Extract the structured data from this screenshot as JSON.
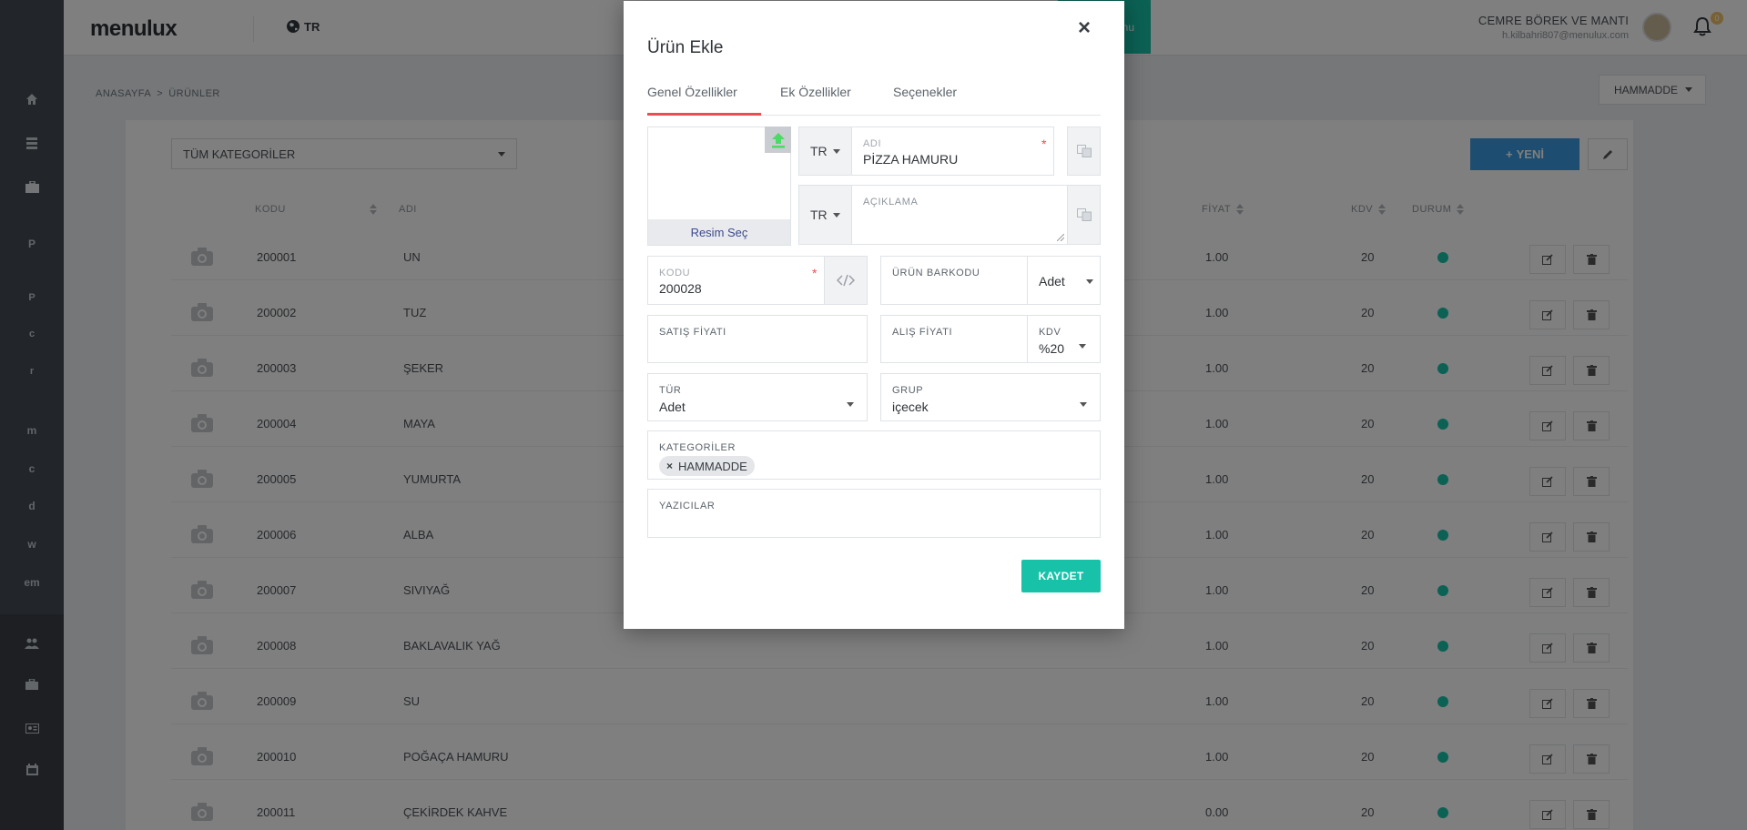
{
  "app": {
    "logo": "menulux",
    "lang": "TR",
    "teal_tab_text": "nu"
  },
  "user": {
    "name": "CEMRE BÖREK VE MANTI",
    "email": "h.kilbahri807@menulux.com",
    "notifications": "0"
  },
  "sidebar": {
    "letters": [
      "P",
      "P",
      "c",
      "r",
      "m",
      "c",
      "d",
      "w",
      "em"
    ]
  },
  "breadcrumb": {
    "home": "ANASAYFA",
    "separator": ">",
    "current": "ÜRÜNLER"
  },
  "top_category": "HAMMADDE",
  "filter": {
    "category": "TÜM KATEGORİLER"
  },
  "actions": {
    "new_label": "YENİ",
    "new_icon": "+"
  },
  "table": {
    "headers": {
      "code": "KODU",
      "name": "ADI",
      "price": "FİYAT",
      "kdv": "KDV",
      "status": "DURUM"
    },
    "rows": [
      {
        "code": "200001",
        "name": "UN",
        "price": "1.00",
        "kdv": "20"
      },
      {
        "code": "200002",
        "name": "TUZ",
        "price": "1.00",
        "kdv": "20"
      },
      {
        "code": "200003",
        "name": "ŞEKER",
        "price": "1.00",
        "kdv": "20"
      },
      {
        "code": "200004",
        "name": "MAYA",
        "price": "1.00",
        "kdv": "20"
      },
      {
        "code": "200005",
        "name": "YUMURTA",
        "price": "1.00",
        "kdv": "20"
      },
      {
        "code": "200006",
        "name": "ALBA",
        "price": "1.00",
        "kdv": "20"
      },
      {
        "code": "200007",
        "name": "SIVIYAĞ",
        "price": "1.00",
        "kdv": "20"
      },
      {
        "code": "200008",
        "name": "BAKLAVALIK YAĞ",
        "price": "1.00",
        "kdv": "20"
      },
      {
        "code": "200009",
        "name": "SU",
        "price": "1.00",
        "kdv": "20"
      },
      {
        "code": "200010",
        "name": "POĞAÇA HAMURU",
        "price": "1.00",
        "kdv": "20"
      },
      {
        "code": "200011",
        "name": "ÇEKİRDEK KAHVE",
        "price": "0.00",
        "kdv": "20"
      }
    ]
  },
  "modal": {
    "title": "Ürün Ekle",
    "close": "×",
    "tabs": [
      "Genel Özellikler",
      "Ek Özellikler",
      "Seçenekler"
    ],
    "image_button": "Resim Seç",
    "name": {
      "lang": "TR",
      "label": "ADI",
      "value": "PİZZA HAMURU",
      "required": "*"
    },
    "description": {
      "lang": "TR",
      "label": "AÇIKLAMA",
      "value": ""
    },
    "code": {
      "label": "KODU",
      "value": "200028",
      "required": "*"
    },
    "barcode": {
      "label": "ÜRÜN BARKODU",
      "value": "",
      "unit": "Adet"
    },
    "sale_price": {
      "label": "SATIŞ FİYATI",
      "value": ""
    },
    "purchase_price": {
      "label": "ALIŞ FİYATI",
      "value": ""
    },
    "kdv": {
      "label": "KDV",
      "value": "%20"
    },
    "type": {
      "label": "TÜR",
      "value": "Adet"
    },
    "group": {
      "label": "GRUP",
      "value": "içecek"
    },
    "categories": {
      "label": "KATEGORİLER",
      "tags": [
        "HAMMADDE"
      ],
      "remove": "×"
    },
    "printers": {
      "label": "YAZICILAR",
      "value": ""
    },
    "save": "KAYDET"
  },
  "colors": {
    "accent_teal": "#17c2a9",
    "tab_red": "#ef4b52",
    "blue": "#3a9be0",
    "upload_green": "#4cd964"
  }
}
